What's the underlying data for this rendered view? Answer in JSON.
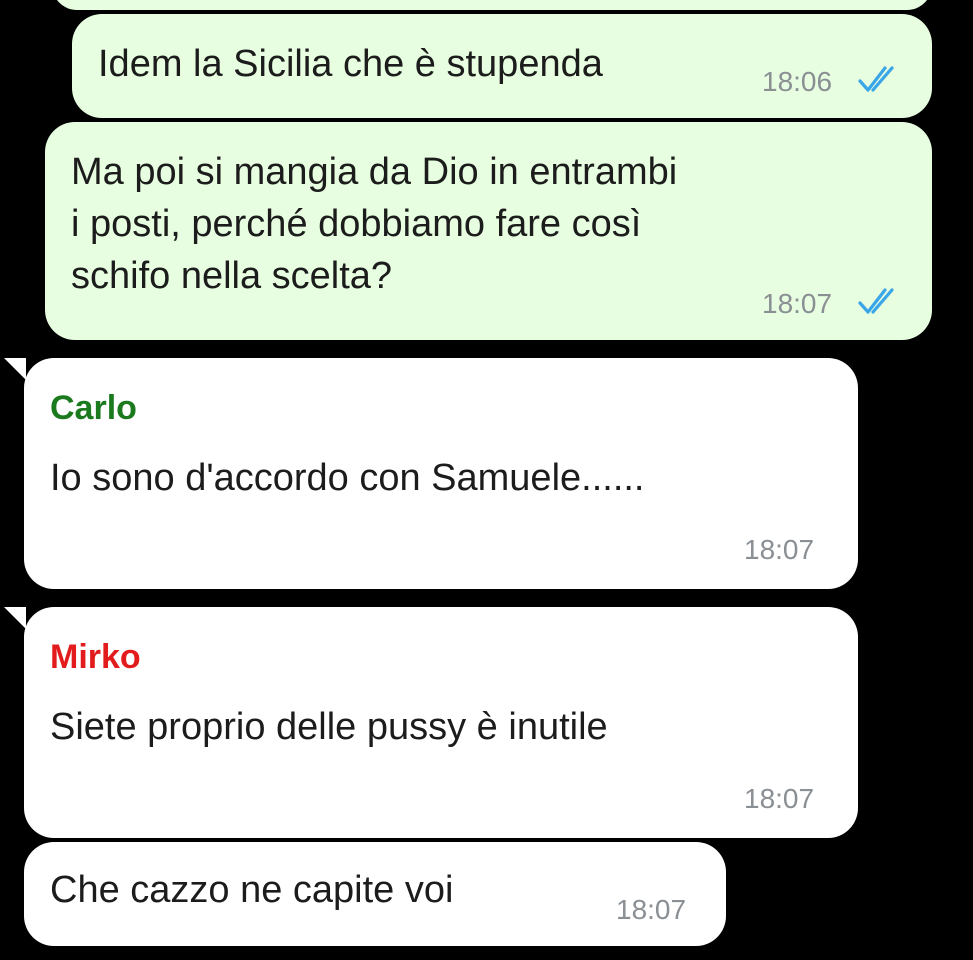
{
  "colors": {
    "background": "#000000",
    "outgoing_bubble": "#e7fee0",
    "incoming_bubble": "#ffffff",
    "read_ticks": "#3aa6e8",
    "timestamp": "#8a8f94",
    "sender_carlo": "#1c7a1e",
    "sender_mirko": "#e21c1c"
  },
  "messages": [
    {
      "direction": "outgoing",
      "text": "Idem la Sicilia che è stupenda",
      "time": "18:06",
      "status_icon": "double-check-read-icon"
    },
    {
      "direction": "outgoing",
      "text": "Ma poi si mangia da Dio in entrambi\ni posti, perché dobbiamo fare così\nschifo nella scelta?",
      "time": "18:07",
      "status_icon": "double-check-read-icon"
    },
    {
      "direction": "incoming",
      "sender": "Carlo",
      "text": "Io sono d'accordo con Samuele......",
      "time": "18:07"
    },
    {
      "direction": "incoming",
      "sender": "Mirko",
      "text": "Siete proprio delle pussy è inutile",
      "time": "18:07"
    },
    {
      "direction": "incoming",
      "text": "Che cazzo ne capite voi",
      "time": "18:07"
    }
  ]
}
